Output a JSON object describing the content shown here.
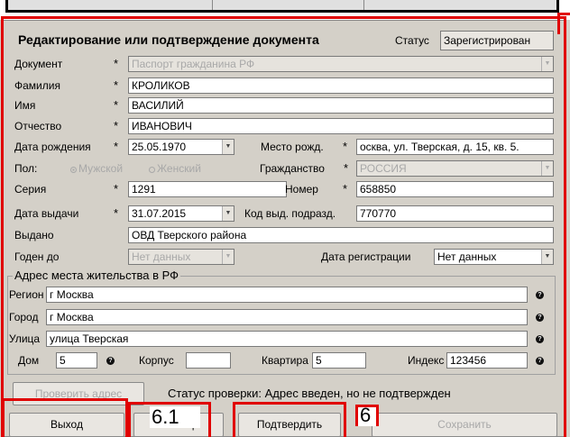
{
  "title": "Редактирование или подтверждение документа",
  "status": {
    "label": "Статус",
    "value": "Зарегистрирован"
  },
  "fields": {
    "document": {
      "label": "Документ",
      "value": "Паспорт гражданина РФ"
    },
    "last_name": {
      "label": "Фамилия",
      "value": "КРОЛИКОВ"
    },
    "first_name": {
      "label": "Имя",
      "value": "ВАСИЛИЙ"
    },
    "patronymic": {
      "label": "Отчество",
      "value": "ИВАНОВИЧ"
    },
    "birth_date": {
      "label": "Дата рождения",
      "value": "25.05.1970"
    },
    "birth_place": {
      "label": "Место рожд.",
      "value": "осква, ул. Тверская, д. 15, кв. 5."
    },
    "sex": {
      "label": "Пол:",
      "male": "Мужской",
      "female": "Женский"
    },
    "citizenship": {
      "label": "Гражданство",
      "value": "РОССИЯ"
    },
    "series": {
      "label": "Серия",
      "value": "1291"
    },
    "number": {
      "label": "Номер",
      "value": "658850"
    },
    "issue_date": {
      "label": "Дата выдачи",
      "value": "31.07.2015"
    },
    "dept_code": {
      "label": "Код выд. подразд.",
      "value": "770770"
    },
    "issued_by": {
      "label": "Выдано",
      "value": "ОВД Тверского района"
    },
    "valid_until": {
      "label": "Годен до",
      "value": "Нет данных"
    },
    "reg_date": {
      "label": "Дата регистрации",
      "value": "Нет данных"
    }
  },
  "address": {
    "title": "Адрес места жительства в РФ",
    "region": {
      "label": "Регион",
      "value": "г Москва"
    },
    "city": {
      "label": "Город",
      "value": "г Москва"
    },
    "street": {
      "label": "Улица",
      "value": "улица Тверская"
    },
    "house": {
      "label": "Дом",
      "value": "5"
    },
    "building": {
      "label": "Корпус",
      "value": ""
    },
    "apartment": {
      "label": "Квартира",
      "value": "5"
    },
    "index": {
      "label": "Индекс",
      "value": "123456"
    }
  },
  "check_button": "Проверить адрес",
  "check_status": "Статус проверки: Адрес введен, но не подтвержден",
  "buttons": {
    "exit": "Выход",
    "help": "Помощь",
    "confirm": "Подтвердить",
    "save": "Сохранить"
  },
  "callouts": {
    "help": "6.1",
    "confirm": "6"
  },
  "icons": {
    "help": "question-circle-icon",
    "dropdown": "triangle-down-icon"
  },
  "colors": {
    "annotation": "#e00000",
    "window_bg": "#d4d0c8"
  }
}
